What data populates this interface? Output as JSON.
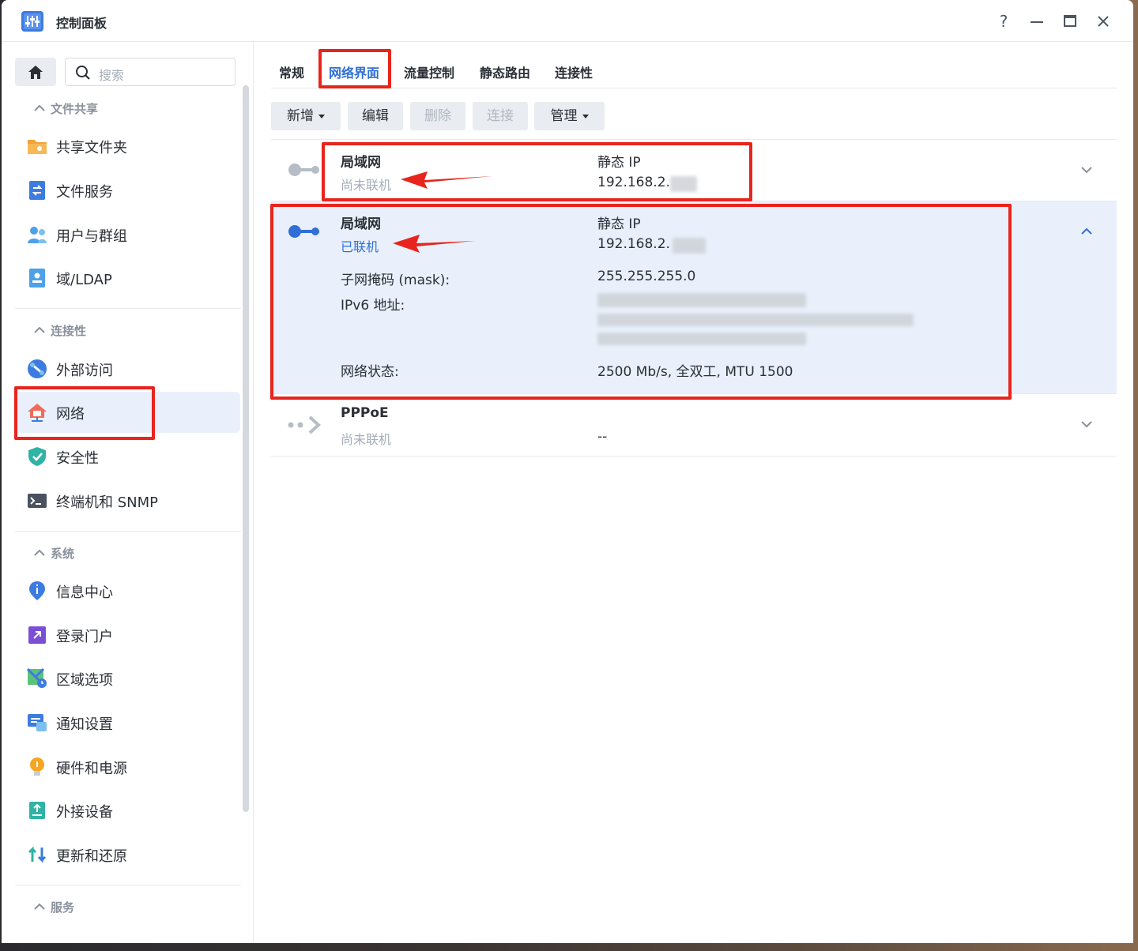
{
  "window": {
    "title": "控制面板",
    "controls": {
      "help": "?",
      "minimize": "—",
      "maximize": "□",
      "close": "✕"
    }
  },
  "sidebar": {
    "search_placeholder": "搜索",
    "groups": [
      {
        "title": "文件共享",
        "items": [
          "共享文件夹",
          "文件服务",
          "用户与群组",
          "域/LDAP"
        ]
      },
      {
        "title": "连接性",
        "items": [
          "外部访问",
          "网络",
          "安全性",
          "终端机和 SNMP"
        ]
      },
      {
        "title": "系统",
        "items": [
          "信息中心",
          "登录门户",
          "区域选项",
          "通知设置",
          "硬件和电源",
          "外接设备",
          "更新和还原"
        ]
      },
      {
        "title": "服务",
        "items": []
      }
    ],
    "active_item": "网络"
  },
  "tabs": [
    "常规",
    "网络界面",
    "流量控制",
    "静态路由",
    "连接性"
  ],
  "active_tab": "网络界面",
  "toolbar": {
    "add": "新增",
    "edit": "编辑",
    "delete": "删除",
    "connect": "连接",
    "manage": "管理"
  },
  "interfaces": [
    {
      "name": "局域网",
      "status": "尚未联机",
      "ip_mode": "静态 IP",
      "ip": "192.168.2."
    },
    {
      "name": "局域网",
      "status": "已联机",
      "ip_mode": "静态 IP",
      "ip": "192.168.2.",
      "subnet_label": "子网掩码 (mask):",
      "subnet": "255.255.255.0",
      "ipv6_label": "IPv6 地址:",
      "net_status_label": "网络状态:",
      "net_status": "2500 Mb/s, 全双工, MTU 1500"
    },
    {
      "name": "PPPoE",
      "status": "尚未联机",
      "ip": "--"
    }
  ],
  "colors": {
    "accent": "#2f6fd6",
    "highlight": "#e8241c"
  }
}
